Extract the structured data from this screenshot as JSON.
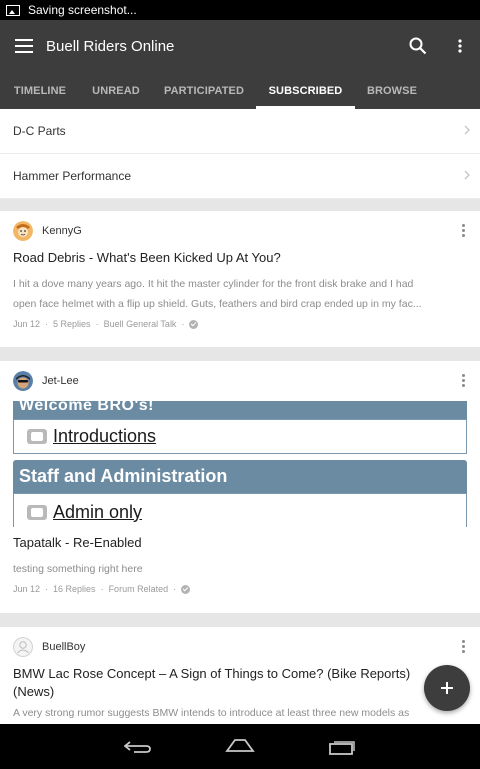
{
  "status_bar": {
    "icon": "screenshot-icon",
    "text": "Saving screenshot..."
  },
  "app_bar": {
    "title": "Buell Riders Online",
    "menu_icon": "hamburger-icon",
    "search_icon": "search-icon",
    "overflow_icon": "more-vert-icon"
  },
  "tabs": [
    {
      "label": "TIMELINE",
      "active": false
    },
    {
      "label": "UNREAD",
      "active": false
    },
    {
      "label": "PARTICIPATED",
      "active": false
    },
    {
      "label": "SUBSCRIBED",
      "active": true
    },
    {
      "label": "BROWSE",
      "active": false
    }
  ],
  "subscribed_forums": [
    {
      "name": "D-C Parts"
    },
    {
      "name": "Hammer Performance"
    }
  ],
  "topics": [
    {
      "author": "KennyG",
      "title": "Road Debris - What's Been Kicked Up At You?",
      "preview_line1": "I hit a dove many years ago. It hit the master cylinder for the front disk brake and I had",
      "preview_line2": "open face helmet with a flip up shield. Guts, feathers and bird crap ended up in my fac...",
      "date": "Jun 12",
      "replies": "5 Replies",
      "forum": "Buell General Talk"
    },
    {
      "author": "Jet-Lee",
      "image": {
        "partial_header": "Welcome BRO's!",
        "link1": "Introductions",
        "section": "Staff and Administration",
        "link2": "Admin only"
      },
      "title": "Tapatalk - Re-Enabled",
      "preview_line1": "testing something right here",
      "date": "Jun 12",
      "replies": "16 Replies",
      "forum": "Forum Related"
    },
    {
      "author": "BuellBoy",
      "title_line1": "BMW Lac Rose Concept – A Sign of Things to Come? (Bike Reports)",
      "title_line2": "(News)",
      "preview_line1": "A very strong rumor suggests BMW intends to introduce at least three new models as"
    }
  ],
  "fab": {
    "icon": "plus-icon"
  },
  "nav_bar": {
    "back_icon": "back-icon",
    "home_icon": "home-icon",
    "recents_icon": "recents-icon"
  },
  "colors": {
    "app_bar": "#3d3d3d",
    "forum_header": "#6b8ba3",
    "background": "#e6e6e6"
  }
}
